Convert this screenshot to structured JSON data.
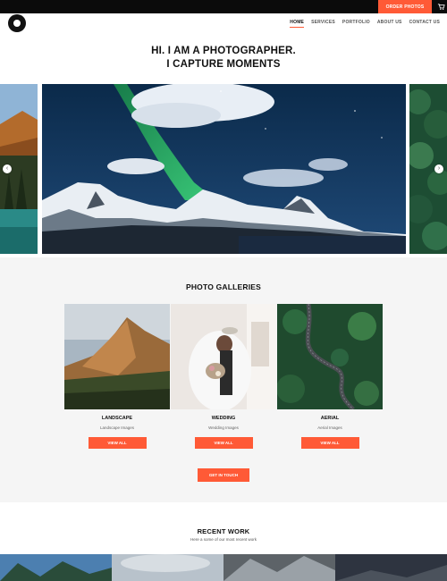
{
  "topbar": {
    "order_label": "ORDER PHOTOS",
    "cart_icon": "cart-icon"
  },
  "nav": {
    "items": [
      {
        "label": "HOME",
        "active": true
      },
      {
        "label": "SERVICES"
      },
      {
        "label": "PORTFOLIO"
      },
      {
        "label": "ABOUT US"
      },
      {
        "label": "CONTACT US"
      }
    ]
  },
  "hero": {
    "line1": "HI. I AM A PHOTOGRAPHER.",
    "line2": "I CAPTURE MOMENTS"
  },
  "carousel": {
    "prev_icon": "chevron-left-icon",
    "next_icon": "chevron-right-icon"
  },
  "galleries": {
    "title": "PHOTO GALLERIES",
    "cards": [
      {
        "title": "LANDSCAPE",
        "subtitle": "Landscape Images",
        "button": "VIEW ALL"
      },
      {
        "title": "WEDDING",
        "subtitle": "Wedding Images",
        "button": "VIEW ALL"
      },
      {
        "title": "AERIAL",
        "subtitle": "Aerial Images",
        "button": "VIEW ALL"
      }
    ],
    "cta": "GET IN TOUCH"
  },
  "recent": {
    "title": "RECENT WORK",
    "subtitle": "Here a some of our most recent work"
  },
  "colors": {
    "accent": "#ff5a36",
    "topbar": "#0b0b0b",
    "section_bg": "#f5f5f5"
  }
}
